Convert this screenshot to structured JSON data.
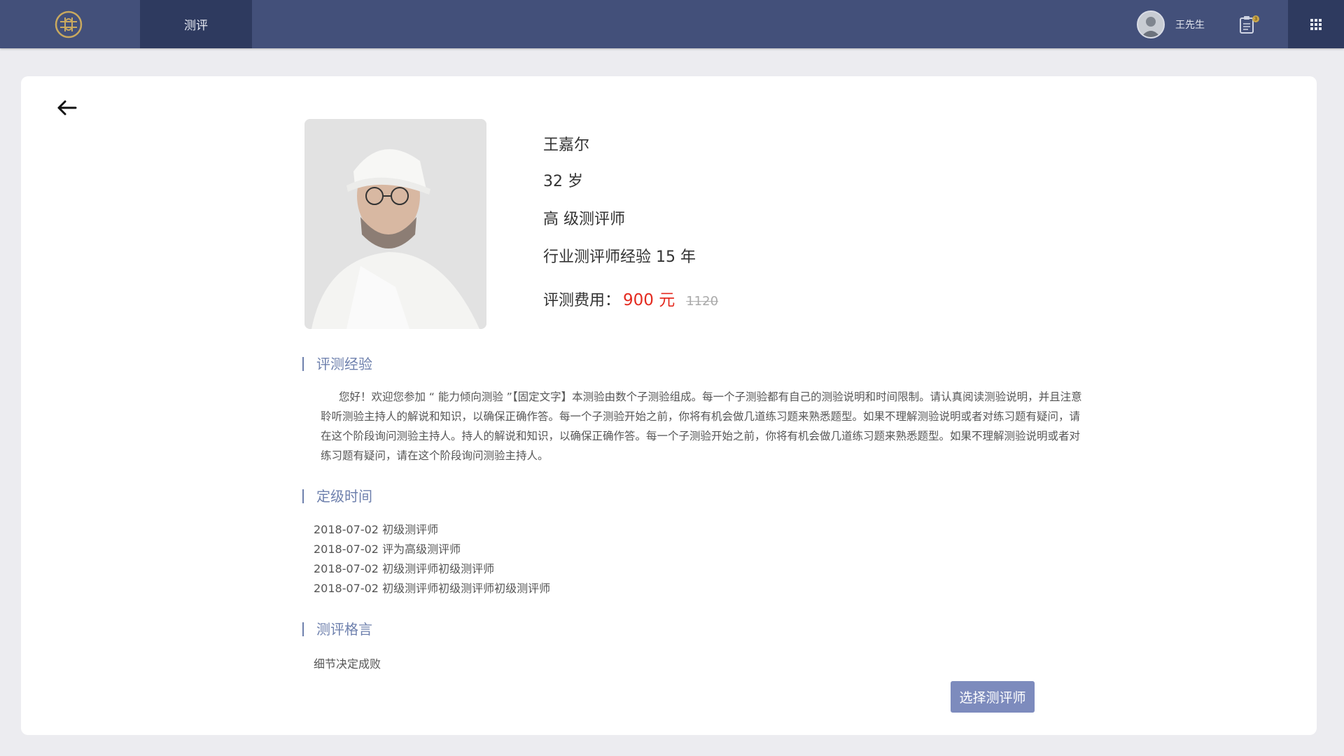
{
  "header": {
    "nav_tab": "测评",
    "user_name": "王先生",
    "notification_count": "3"
  },
  "profile": {
    "name": "王嘉尔",
    "age": "32 岁",
    "level": "高 级测评师",
    "experience": "行业测评师经验 15 年",
    "fee_label": "评测费用：",
    "fee": "900 元",
    "original_fee": "1120"
  },
  "sections": {
    "experience_title": "评测经验",
    "experience_text": "您好！欢迎您参加 “ 能力倾向测验 ”【固定文字】本测验由数个子测验组成。每一个子测验都有自己的测验说明和时间限制。请认真阅读测验说明，并且注意聆听测验主持人的解说和知识，以确保正确作答。每一个子测验开始之前，你将有机会做几道练习题来熟悉题型。如果不理解测验说明或者对练习题有疑问，请在这个阶段询问测验主持人。持人的解说和知识，以确保正确作答。每一个子测验开始之前，你将有机会做几道练习题来熟悉题型。如果不理解测验说明或者对练习题有疑问，请在这个阶段询问测验主持人。",
    "rating_time_title": "定级时间",
    "rating_items": [
      "2018-07-02 初级测评师",
      "2018-07-02 评为高级测评师",
      "2018-07-02 初级测评师初级测评师",
      "2018-07-02 初级测评师初级测评师初级测评师"
    ],
    "motto_title": "测评格言",
    "motto_text": "细节决定成败"
  },
  "actions": {
    "select_button": "选择测评师"
  },
  "colors": {
    "header_bg": "#43507a",
    "active_tab_bg": "#2e3a5f",
    "accent": "#6e80ad",
    "price": "#e42b20",
    "button": "#7d8bbd"
  }
}
